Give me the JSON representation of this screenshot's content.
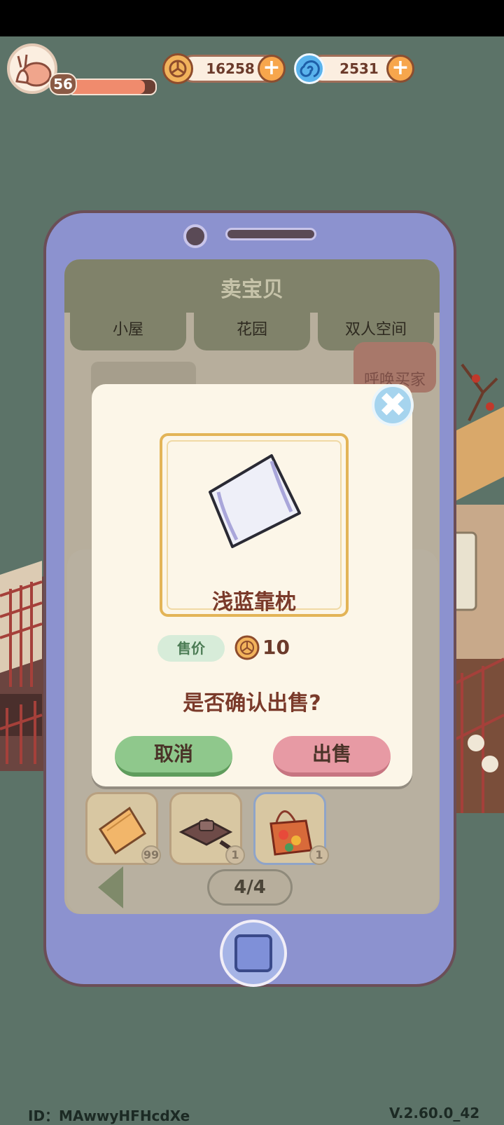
{
  "player": {
    "level": "56",
    "xp_fraction": 0.88
  },
  "currency": {
    "coins": {
      "value": "16258",
      "icon": "coin-icon"
    },
    "gems": {
      "value": "2531",
      "icon": "swirl-gem-icon"
    }
  },
  "shop": {
    "title": "卖宝贝",
    "tabs": [
      "小屋",
      "花园",
      "双人空间"
    ],
    "callout_label": "呼唤买家",
    "slots": [
      {
        "name": "orange-pillow",
        "count": "99"
      },
      {
        "name": "grill-pan",
        "count": "1"
      },
      {
        "name": "flower-basket",
        "count": "1"
      }
    ],
    "page": "4/4"
  },
  "dialog": {
    "item_name": "浅蓝靠枕",
    "price_label": "售价",
    "price_value": "10",
    "question": "是否确认出售?",
    "cancel_label": "取消",
    "sell_label": "出售",
    "close_symbol": "✖"
  },
  "footer": {
    "id": "ID：MAwwyHFHcdXe",
    "version": "V.2.60.0_42"
  },
  "colors": {
    "accent_green": "#8fc88c",
    "accent_pink": "#e79aa4",
    "phone_body": "#8c92cf"
  }
}
